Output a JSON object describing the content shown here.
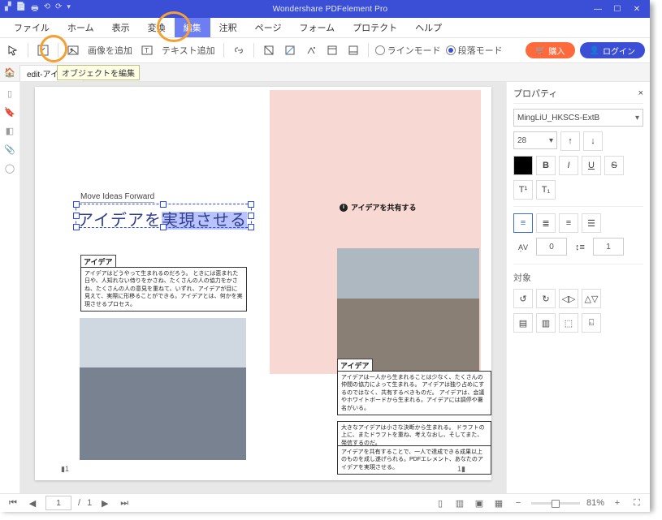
{
  "title": "Wondershare PDFelement Pro",
  "menu": {
    "file": "ファイル",
    "home": "ホーム",
    "view": "表示",
    "convert": "変換",
    "edit": "編集",
    "annot": "注釈",
    "page": "ページ",
    "form": "フォーム",
    "protect": "プロテクト",
    "help": "ヘルプ"
  },
  "toolbar": {
    "addimg": "画像を追加",
    "addtext": "テキスト追加",
    "linemode": "ラインモード",
    "paramode": "段落モード",
    "buy": "購入",
    "login": "ログイン"
  },
  "tab": {
    "name": "edit-アイ…"
  },
  "tooltip": "オブジェクトを編集",
  "panel": {
    "title": "プロパティ",
    "font": "MingLiU_HKSCS-ExtB",
    "size": "28",
    "target": "対象",
    "align_val": "0",
    "lh_val": "1"
  },
  "doc": {
    "moveideas": "Move Ideas Forward",
    "bigjp_a": "アイデアを",
    "bigjp_b": "実現させる",
    "share": "アイデアを共有する",
    "idea": "アイデア",
    "p1": "アイデアはどうやって生まれるのだろう。\nときには恵まれた日や、人知れない侍りをかさね、たくさんの人の協力をかさね、たくさんの人の意見を重ねて、いずれ、アイデアが目に見えて、実際に形移ることができる。アイデアとは、何かを実現させるプロセス。",
    "p2": "アイデアは一人から生まれることは少なく、たくさんの仲間の協力によって生まれる。\nアイデアは独り占めにするのではなく、共有するべきものだ。\nアイデアは、会議やホワイトボードから生まれる。アイデアには調停や署名がいる。",
    "p3": "大きなアイデアは小さな決断から生まれる。\nドラフトの上に、またドラフトを重ね、考えなおし、そしてまた、発信するのだ。",
    "p4": "アイデアを共有することで、一人で達成できる成果以上のものを成し遂げられる。PDFエレメント、あなたのアイデアを実現させる。"
  },
  "status": {
    "page": "1",
    "sep": "/",
    "total": "1",
    "zoom": "81%"
  }
}
